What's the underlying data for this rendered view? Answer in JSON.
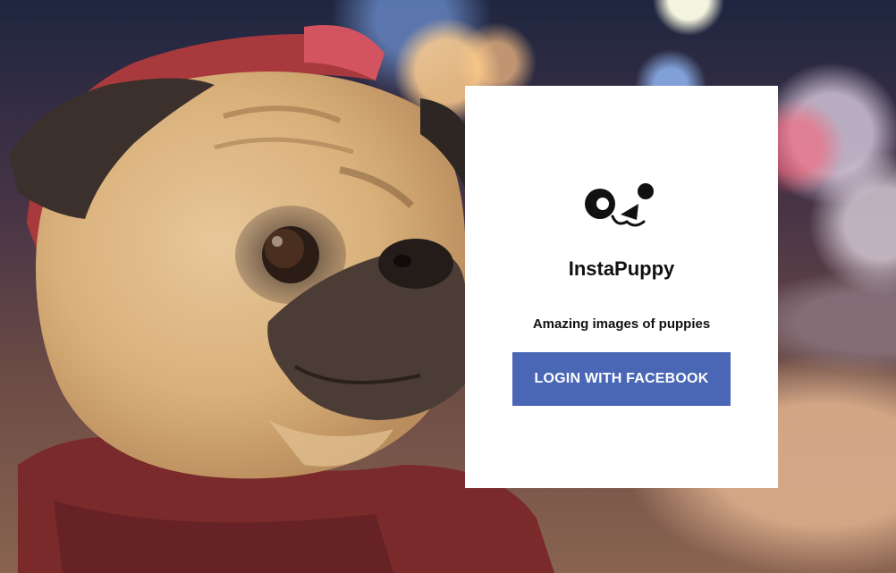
{
  "background": {
    "image_icon": "pug-photo"
  },
  "card": {
    "logo_icon": "puppy-face-icon",
    "app_name": "InstaPuppy",
    "tagline": "Amazing images of puppies",
    "login_button_label": "LOGIN WITH FACEBOOK"
  },
  "colors": {
    "card_background": "#ffffff",
    "button_background": "#4a67b6",
    "button_text": "#ffffff",
    "text": "#111111"
  }
}
